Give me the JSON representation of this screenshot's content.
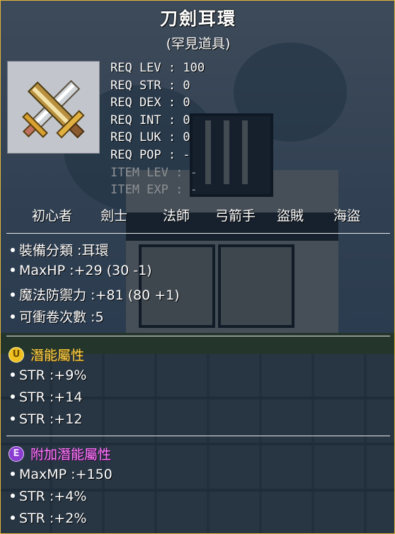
{
  "item": {
    "name": "刀劍耳環",
    "rarity": "(罕見道具)",
    "icon": "sword-earring-icon"
  },
  "requirements": [
    {
      "label": "REQ LEV",
      "value": "100",
      "dim": false
    },
    {
      "label": "REQ STR",
      "value": "0",
      "dim": false
    },
    {
      "label": "REQ DEX",
      "value": "0",
      "dim": false
    },
    {
      "label": "REQ INT",
      "value": "0",
      "dim": false
    },
    {
      "label": "REQ LUK",
      "value": "0",
      "dim": false
    },
    {
      "label": "REQ POP",
      "value": "-",
      "dim": false
    },
    {
      "label": "ITEM LEV",
      "value": "-",
      "dim": true
    },
    {
      "label": "ITEM EXP",
      "value": "-",
      "dim": true
    }
  ],
  "jobs": [
    "初心者",
    "劍士",
    "法師",
    "弓箭手",
    "盜賊",
    "海盜"
  ],
  "base_stats": [
    "裝備分類 :耳環",
    "MaxHP :+29 (30 -1)",
    "魔法防禦力 :+81 (80 +1)",
    "可衝卷次數 :5"
  ],
  "potential": {
    "badge": "U",
    "title": "潛能屬性",
    "lines": [
      "STR :+9%",
      "STR :+14",
      "STR :+12"
    ]
  },
  "bonus_potential": {
    "badge": "E",
    "title": "附加潛能屬性",
    "lines": [
      "MaxMP :+150",
      "STR :+4%",
      "STR :+2%"
    ]
  },
  "colors": {
    "border": "#e2b53b",
    "potential_text": "#ffd34a",
    "bonus_text": "#ff7cff",
    "dim_text": "#8d9094"
  }
}
